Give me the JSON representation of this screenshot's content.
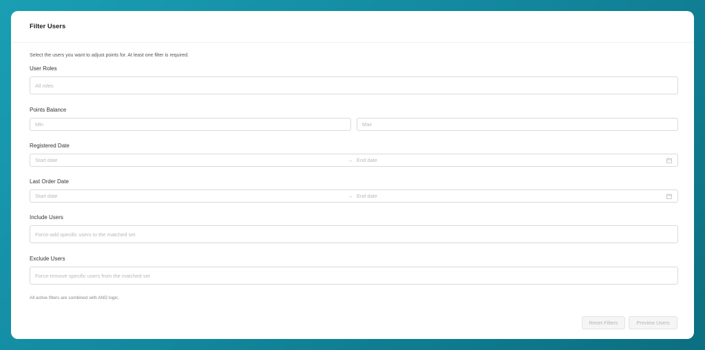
{
  "header": {
    "title": "Filter Users"
  },
  "description": "Select the users you want to adjust points for. At least one filter is required.",
  "user_roles": {
    "label": "User Roles",
    "placeholder": "All roles"
  },
  "points_balance": {
    "label": "Points Balance",
    "min_placeholder": "Min",
    "max_placeholder": "Max"
  },
  "registered_date": {
    "label": "Registered Date",
    "start_placeholder": "Start date",
    "end_placeholder": "End date"
  },
  "last_order_date": {
    "label": "Last Order Date",
    "start_placeholder": "Start date",
    "end_placeholder": "End date"
  },
  "include_users": {
    "label": "Include Users",
    "placeholder": "Force-add specific users to the matched set"
  },
  "exclude_users": {
    "label": "Exclude Users",
    "placeholder": "Force-remove specific users from the matched set"
  },
  "footnote": "All active filters are combined with AND logic.",
  "actions": {
    "reset_label": "Reset Filters",
    "preview_label": "Preview Users"
  },
  "icons": {
    "range_separator": "arrow-right-icon",
    "calendar": "calendar-icon"
  },
  "colors": {
    "background_start": "#1a9eb4",
    "background_end": "#0b6f80",
    "card": "#ffffff",
    "border": "#d9d9d9"
  }
}
